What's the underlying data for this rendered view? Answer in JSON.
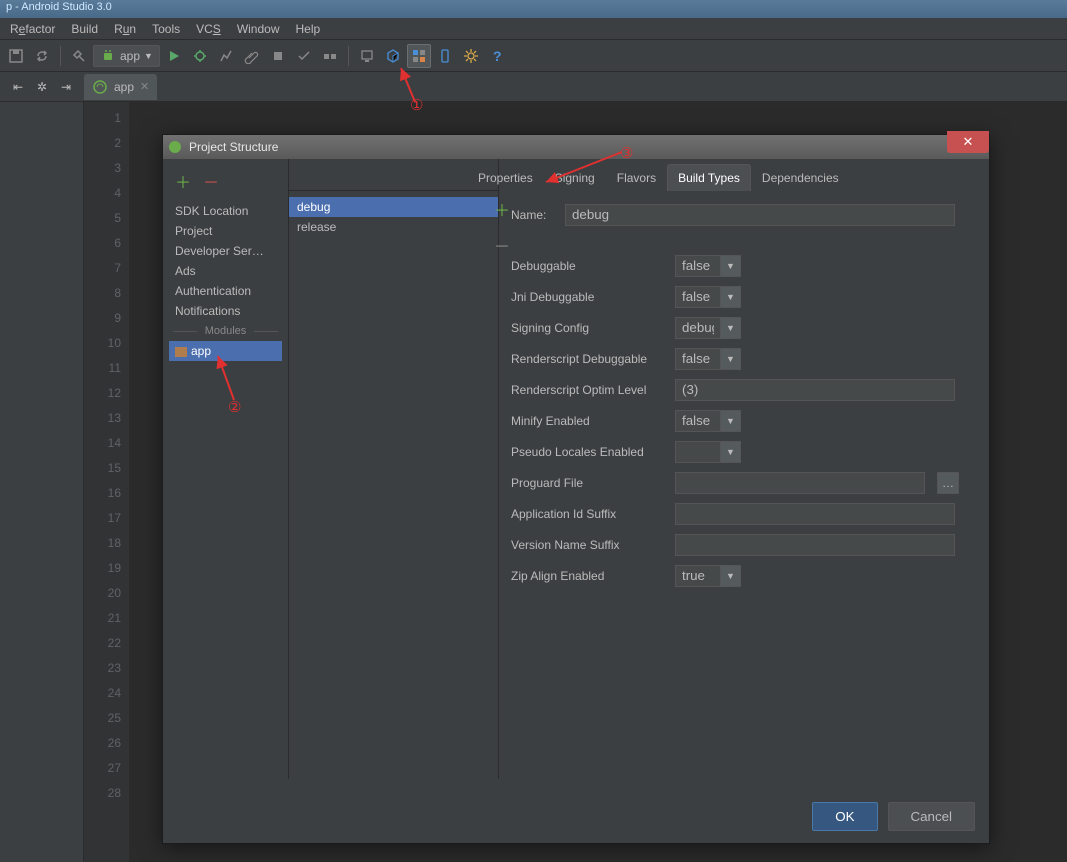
{
  "title_bar": "p - Android Studio 3.0",
  "menu": {
    "refactor": "Refactor",
    "build": "Build",
    "run": "Run",
    "tools": "Tools",
    "vcs": "VCS",
    "window": "Window",
    "help": "Help"
  },
  "toolbar": {
    "app_combo": "app"
  },
  "editor_tab": {
    "label": "app"
  },
  "gutter_lines": [
    "1",
    "2",
    "3",
    "4",
    "5",
    "6",
    "7",
    "8",
    "9",
    "10",
    "11",
    "12",
    "13",
    "14",
    "15",
    "16",
    "17",
    "18",
    "19",
    "20",
    "21",
    "22",
    "23",
    "24",
    "25",
    "26",
    "27",
    "28"
  ],
  "dialog": {
    "title": "Project Structure",
    "sidebar": {
      "items": [
        "SDK Location",
        "Project",
        "Developer Ser…",
        "Ads",
        "Authentication",
        "Notifications"
      ],
      "modules_header": "Modules",
      "module": "app"
    },
    "tabs": [
      "Properties",
      "Signing",
      "Flavors",
      "Build Types",
      "Dependencies"
    ],
    "active_tab": "Build Types",
    "types": [
      "debug",
      "release"
    ],
    "selected_type": "debug",
    "form": {
      "name_label": "Name:",
      "name_value": "debug",
      "rows": [
        {
          "label": "Debuggable",
          "value": "false",
          "type": "select"
        },
        {
          "label": "Jni Debuggable",
          "value": "false",
          "type": "select"
        },
        {
          "label": "Signing Config",
          "value": "debug",
          "type": "select"
        },
        {
          "label": "Renderscript Debuggable",
          "value": "false",
          "type": "select"
        },
        {
          "label": "Renderscript Optim Level",
          "value": "(3)",
          "type": "text"
        },
        {
          "label": "Minify Enabled",
          "value": "false",
          "type": "select"
        },
        {
          "label": "Pseudo Locales Enabled",
          "value": "",
          "type": "select"
        },
        {
          "label": "Proguard File",
          "value": "",
          "type": "file"
        },
        {
          "label": "Application Id Suffix",
          "value": "",
          "type": "text"
        },
        {
          "label": "Version Name Suffix",
          "value": "",
          "type": "text"
        },
        {
          "label": "Zip Align Enabled",
          "value": "true",
          "type": "select"
        }
      ]
    },
    "footer": {
      "ok": "OK",
      "cancel": "Cancel"
    }
  },
  "annotations": {
    "one": "①",
    "two": "②",
    "three": "③"
  }
}
